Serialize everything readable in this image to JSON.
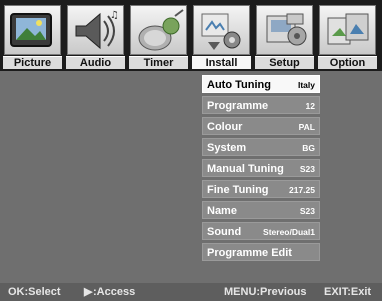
{
  "tabs": [
    {
      "label": "Picture",
      "icon": "picture-icon"
    },
    {
      "label": "Audio",
      "icon": "audio-icon"
    },
    {
      "label": "Timer",
      "icon": "timer-icon"
    },
    {
      "label": "Install",
      "icon": "install-icon"
    },
    {
      "label": "Setup",
      "icon": "setup-icon"
    },
    {
      "label": "Option",
      "icon": "option-icon"
    }
  ],
  "active_tab": "Install",
  "menu": [
    {
      "label": "Auto Tuning",
      "value": "Italy"
    },
    {
      "label": "Programme",
      "value": "12"
    },
    {
      "label": "Colour",
      "value": "PAL"
    },
    {
      "label": "System",
      "value": "BG"
    },
    {
      "label": "Manual Tuning",
      "value": "S23"
    },
    {
      "label": "Fine Tuning",
      "value": "217.25"
    },
    {
      "label": "Name",
      "value": "S23"
    },
    {
      "label": "Sound",
      "value": "Stereo/Dual1"
    },
    {
      "label": "Programme Edit",
      "value": ""
    }
  ],
  "selected_item": "Auto Tuning",
  "footer": {
    "ok_hint": "OK:Select",
    "access_hint": ":Access",
    "menu_hint": "MENU:Previous",
    "exit_hint": "EXIT:Exit"
  }
}
